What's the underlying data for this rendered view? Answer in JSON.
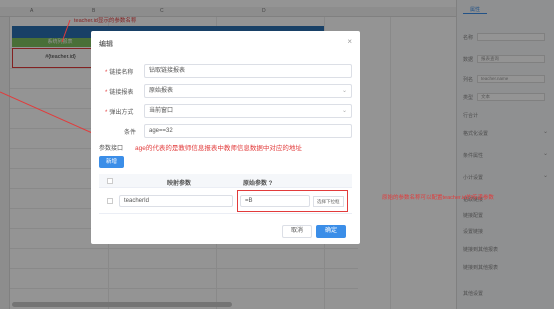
{
  "sheet": {
    "columns": [
      "A",
      "B",
      "C",
      "D"
    ],
    "green_cell": "系统列报表",
    "red_cell": "#{teacher.id}",
    "red_note_top": "teacher.id显示的参数名称"
  },
  "right_panel": {
    "tab": "属性",
    "rows": [
      {
        "label": "名称",
        "value": ""
      },
      {
        "label": "数据",
        "value": "报表查询"
      },
      {
        "label": "列名",
        "value": "teacher.name"
      },
      {
        "label": "类型",
        "value": "文本"
      },
      {
        "label": "行合计",
        "value": ""
      },
      {
        "label": "格式化设置",
        "value": ""
      },
      {
        "label": "条件属性",
        "value": ""
      },
      {
        "label": "小计设置",
        "value": ""
      },
      {
        "label": "钻取链接",
        "value": ""
      },
      {
        "label": "链接配置",
        "value": ""
      },
      {
        "label": "设置链接",
        "value": ""
      },
      {
        "label": "链接到其他报表",
        "value": ""
      },
      {
        "label": "链接到其他报表",
        "value": ""
      },
      {
        "label": "其他设置",
        "value": ""
      }
    ],
    "red_note": "原始的参数名称可以配置teacher.id的传递参数"
  },
  "modal": {
    "title": "编辑",
    "close": "×",
    "fields": {
      "name_label": "链接名称",
      "name_value": "钻取链接报表",
      "report_label": "链接报表",
      "report_value": "原始报表",
      "open_label": "弹出方式",
      "open_value": "当前窗口",
      "condition_label": "条件",
      "condition_value": "age==32"
    },
    "param_label": "参数接口",
    "red_note": "age的代表的是教师信息报表中教师信息数据中对应的地址",
    "add_button": "新增",
    "table": {
      "col_map": "映射参数",
      "col_src": "原始参数 ?",
      "row_map": "teacherId",
      "row_src": "=B",
      "row_btn": "选择下拉框"
    },
    "cancel": "取消",
    "ok": "确定"
  }
}
